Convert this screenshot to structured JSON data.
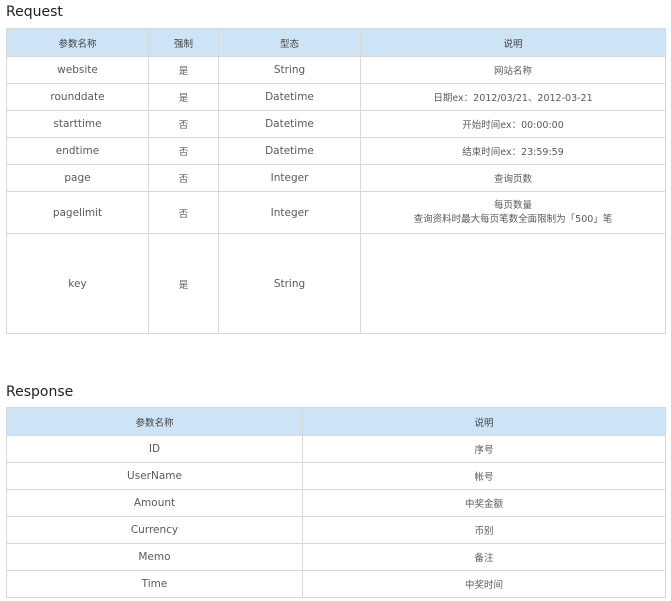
{
  "request": {
    "title": "Request",
    "headers": [
      "参数名称",
      "强制",
      "型态",
      "说明"
    ],
    "rows": [
      {
        "name": "website",
        "required": "是",
        "type": "String",
        "desc": [
          "网站名称"
        ]
      },
      {
        "name": "rounddate",
        "required": "是",
        "type": "Datetime",
        "desc": [
          "日期ex：2012/03/21、2012-03-21"
        ]
      },
      {
        "name": "starttime",
        "required": "否",
        "type": "Datetime",
        "desc": [
          "开始时间ex：00:00:00"
        ]
      },
      {
        "name": "endtime",
        "required": "否",
        "type": "Datetime",
        "desc": [
          "结束时间ex：23:59:59"
        ]
      },
      {
        "name": "page",
        "required": "否",
        "type": "Integer",
        "desc": [
          "查询页数"
        ]
      },
      {
        "name": "pagelimit",
        "required": "否",
        "type": "Integer",
        "desc": [
          "每页数量",
          "查询资料时最大每页笔数全面限制为「500」笔"
        ]
      },
      {
        "name": "key",
        "required": "是",
        "type": "String",
        "desc": [
          ""
        ]
      }
    ]
  },
  "response": {
    "title": "Response",
    "headers": [
      "参数名称",
      "说明"
    ],
    "rows": [
      {
        "name": "ID",
        "desc": "序号"
      },
      {
        "name": "UserName",
        "desc": "帐号"
      },
      {
        "name": "Amount",
        "desc": "中奖金额"
      },
      {
        "name": "Currency",
        "desc": "币别"
      },
      {
        "name": "Memo",
        "desc": "备注"
      },
      {
        "name": "Time",
        "desc": "中奖时间"
      }
    ]
  }
}
